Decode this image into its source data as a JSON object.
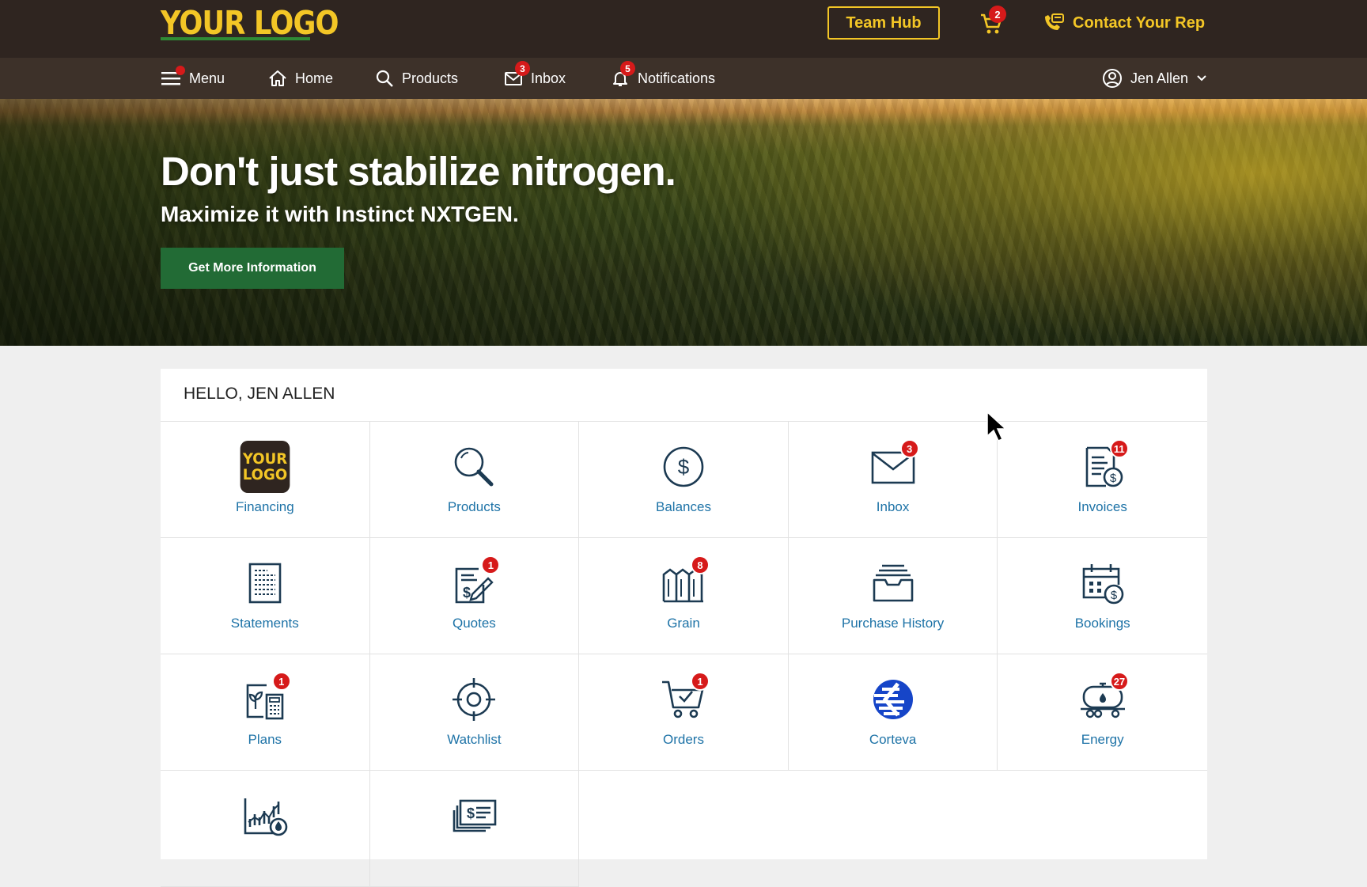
{
  "header": {
    "logo_text": "YOUR LOGO",
    "team_hub_label": "Team Hub",
    "cart_count": "2",
    "contact_label": "Contact Your Rep"
  },
  "nav": {
    "menu_label": "Menu",
    "home_label": "Home",
    "products_label": "Products",
    "inbox_label": "Inbox",
    "inbox_count": "3",
    "notifications_label": "Notifications",
    "notifications_count": "5",
    "user_name": "Jen Allen"
  },
  "hero": {
    "title": "Don't just stabilize nitrogen.",
    "subtitle": "Maximize it with Instinct NXTGEN.",
    "button_label": "Get More Information"
  },
  "dashboard": {
    "greeting": "HELLO, JEN ALLEN",
    "tiles": [
      {
        "label": "Financing",
        "icon": "financing-logo-icon",
        "badge": ""
      },
      {
        "label": "Products",
        "icon": "search-icon",
        "badge": ""
      },
      {
        "label": "Balances",
        "icon": "dollar-circle-icon",
        "badge": ""
      },
      {
        "label": "Inbox",
        "icon": "envelope-icon",
        "badge": "3"
      },
      {
        "label": "Invoices",
        "icon": "invoice-icon",
        "badge": "11"
      },
      {
        "label": "Statements",
        "icon": "statement-icon",
        "badge": ""
      },
      {
        "label": "Quotes",
        "icon": "quote-icon",
        "badge": "1"
      },
      {
        "label": "Grain",
        "icon": "grain-bins-icon",
        "badge": "8"
      },
      {
        "label": "Purchase History",
        "icon": "archive-box-icon",
        "badge": ""
      },
      {
        "label": "Bookings",
        "icon": "calendar-dollar-icon",
        "badge": ""
      },
      {
        "label": "Plans",
        "icon": "plant-calculator-icon",
        "badge": "1"
      },
      {
        "label": "Watchlist",
        "icon": "target-icon",
        "badge": ""
      },
      {
        "label": "Orders",
        "icon": "cart-check-icon",
        "badge": "1"
      },
      {
        "label": "Corteva",
        "icon": "corteva-logo-icon",
        "badge": ""
      },
      {
        "label": "Energy",
        "icon": "fuel-tank-icon",
        "badge": "27"
      },
      {
        "label": "",
        "icon": "market-chart-icon",
        "badge": ""
      },
      {
        "label": "",
        "icon": "check-payment-icon",
        "badge": ""
      }
    ]
  },
  "colors": {
    "header_bg": "#2f2520",
    "nav_bg": "#3d3129",
    "brand_yellow": "#f3c626",
    "badge_red": "#d61a1a",
    "cta_green": "#226b35",
    "link_blue": "#1e73a7",
    "icon_navy": "#1c3a52"
  }
}
